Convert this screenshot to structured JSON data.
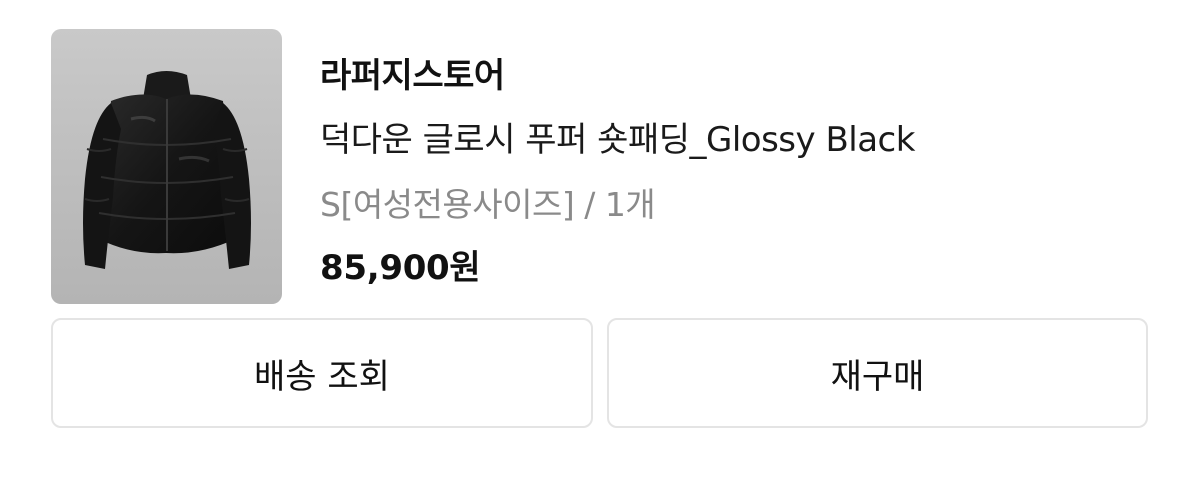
{
  "order_item": {
    "store_name": "라퍼지스토어",
    "product_name": "덕다운 글로시 푸퍼 숏패딩_Glossy Black",
    "option_text": "S[여성전용사이즈] / 1개",
    "price": "85,900원",
    "image_icon": "black-puffer-jacket-image"
  },
  "actions": {
    "track_label": "배송 조회",
    "rebuy_label": "재구매"
  },
  "colors": {
    "text_primary": "#111111",
    "text_secondary": "#8a8a8a",
    "button_border": "#e4e4e4",
    "thumbnail_bg": "#c4c4c4"
  }
}
